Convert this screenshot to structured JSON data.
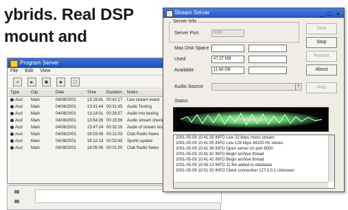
{
  "article": {
    "line1": "ybrids. Real DSP",
    "line2": "mount and"
  },
  "back_window": {
    "title": "Program Server",
    "menu": [
      "File",
      "Edit",
      "View"
    ],
    "table_headers": [
      "Type",
      "Clip",
      "Date",
      "Time",
      "Duration",
      "Notes"
    ],
    "rows": [
      [
        "Aud",
        "Main",
        "04/08/2001",
        "13:16:41",
        "00:42:17",
        "Live stream event"
      ],
      [
        "Aud",
        "Main",
        "04/08/2001",
        "13:41:44",
        "00:31:45",
        "Audio Testing"
      ],
      [
        "Aud",
        "Main",
        "04/08/2001",
        "13:14:01",
        "00:29:57",
        "Audio mix testing"
      ],
      [
        "Aud",
        "Main",
        "04/08/2001",
        "13:54:26",
        "00:15:56",
        "Audio stream check"
      ],
      [
        "Aud",
        "Main",
        "04/08/2001",
        "13:47:24",
        "00:32:16",
        "Audio of stream test"
      ],
      [
        "Aud",
        "Main",
        "04/08/2001",
        "16:33:08",
        "00:21:03",
        "Club Radio News"
      ],
      [
        "Aud",
        "Main",
        "04/08/2001",
        "16:12:13",
        "00:02:45",
        "Sports update"
      ],
      [
        "Aud",
        "Main",
        "04/08/2001",
        "16:05:06",
        "00:01:00",
        "Club Radio News"
      ]
    ]
  },
  "front_window": {
    "title": "Stream Server",
    "window_buttons": "_ □ ×",
    "labels": {
      "server_info": "Server Info",
      "server_port": "Server Port",
      "disk_space": "Max Disk Space",
      "used": "Used",
      "available": "Available",
      "audio_source": "Audio Source",
      "status": "Status"
    },
    "values": {
      "server_port": "8000",
      "used": "47.37 MB",
      "available": "11.68 GB"
    },
    "buttons": {
      "start": "Start",
      "stop": "Stop",
      "restart": "Restart",
      "about": "About",
      "help": "Help"
    },
    "log_lines": [
      "2001-05-09 10:41:35 INFO  Live 32 kbps  mono stream",
      "2001-05-09 10:41:35 INFO  Live 128 kbps 44100 Hz stereo",
      "2001-05-09 10:41:36 INFO  Open server on port 8000",
      "2001-05-09 10:41:42 INFO  Begin archive thread",
      "2001-05-09 10:41:42 INFO  Begin archive thread",
      "2001-05-09 10:45:13 INFO  11 file added to database",
      "2001-05-09 10:51:30 INFO  Client connection 127.0.0.1 Unknown"
    ]
  }
}
